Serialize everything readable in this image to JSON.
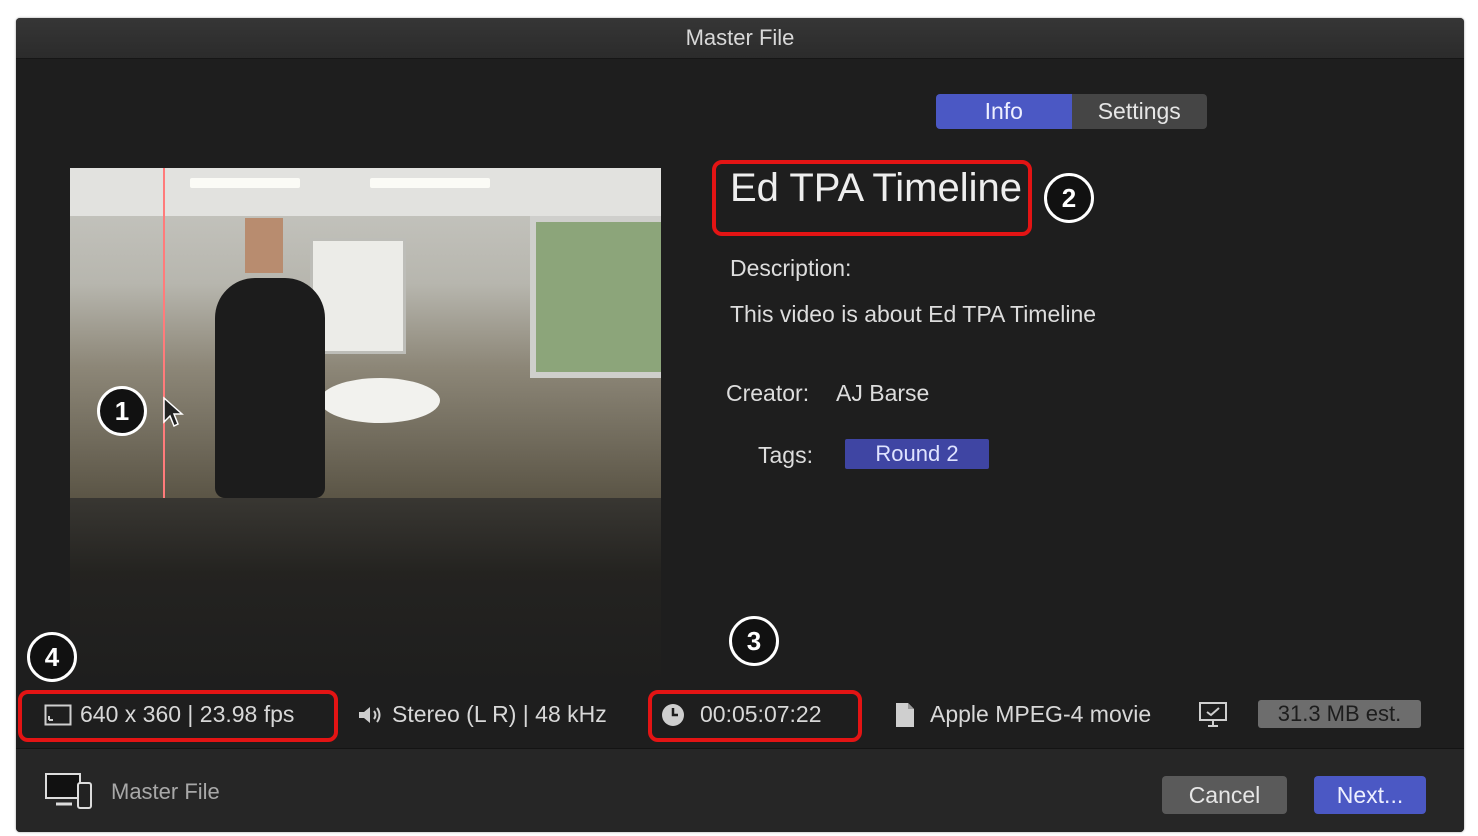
{
  "window": {
    "title": "Master File"
  },
  "tabs": [
    {
      "label": "Info",
      "active": true
    },
    {
      "label": "Settings",
      "active": false
    }
  ],
  "info": {
    "title": "Ed TPA Timeline",
    "description_label": "Description:",
    "description_text": "This video is about Ed TPA Timeline",
    "creator_label": "Creator:",
    "creator_value": "AJ Barse",
    "tags_label": "Tags:",
    "tag": "Round 2"
  },
  "stats": {
    "resolution": "640 x 360 | 23.98 fps",
    "audio": "Stereo (L R) | 48 kHz",
    "duration": "00:05:07:22",
    "format": "Apple MPEG-4 movie",
    "size_estimate": "31.3 MB est."
  },
  "footer": {
    "destination_label": "Master File",
    "cancel_label": "Cancel",
    "next_label": "Next..."
  },
  "annotations": [
    "1",
    "2",
    "3",
    "4"
  ],
  "colors": {
    "accent": "#4b58c4",
    "highlight": "#e31414",
    "window_bg": "#1e1e1e"
  },
  "icons": [
    "display-icon",
    "speaker-icon",
    "clock-icon",
    "document-icon",
    "monitor-icon",
    "devices-icon",
    "cursor-icon"
  ]
}
